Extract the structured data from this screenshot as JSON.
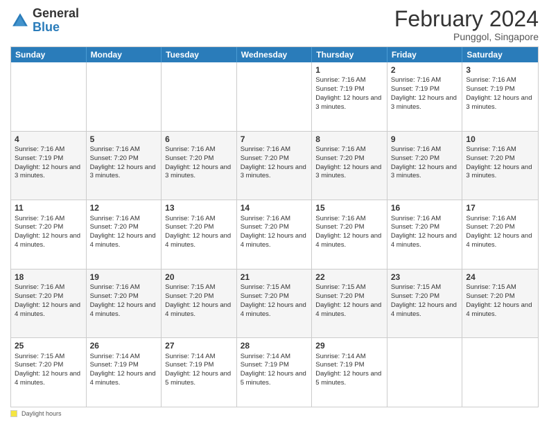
{
  "header": {
    "logo_general": "General",
    "logo_blue": "Blue",
    "month_title": "February 2024",
    "location": "Punggol, Singapore"
  },
  "weekdays": [
    "Sunday",
    "Monday",
    "Tuesday",
    "Wednesday",
    "Thursday",
    "Friday",
    "Saturday"
  ],
  "footer": {
    "daylight_label": "Daylight hours"
  },
  "rows": [
    {
      "cells": [
        {
          "empty": true
        },
        {
          "empty": true
        },
        {
          "empty": true
        },
        {
          "empty": true
        },
        {
          "day": "1",
          "sunrise": "7:16 AM",
          "sunset": "7:19 PM",
          "daylight": "12 hours and 3 minutes."
        },
        {
          "day": "2",
          "sunrise": "7:16 AM",
          "sunset": "7:19 PM",
          "daylight": "12 hours and 3 minutes."
        },
        {
          "day": "3",
          "sunrise": "7:16 AM",
          "sunset": "7:19 PM",
          "daylight": "12 hours and 3 minutes."
        }
      ],
      "alt": false
    },
    {
      "cells": [
        {
          "day": "4",
          "sunrise": "7:16 AM",
          "sunset": "7:19 PM",
          "daylight": "12 hours and 3 minutes."
        },
        {
          "day": "5",
          "sunrise": "7:16 AM",
          "sunset": "7:20 PM",
          "daylight": "12 hours and 3 minutes."
        },
        {
          "day": "6",
          "sunrise": "7:16 AM",
          "sunset": "7:20 PM",
          "daylight": "12 hours and 3 minutes."
        },
        {
          "day": "7",
          "sunrise": "7:16 AM",
          "sunset": "7:20 PM",
          "daylight": "12 hours and 3 minutes."
        },
        {
          "day": "8",
          "sunrise": "7:16 AM",
          "sunset": "7:20 PM",
          "daylight": "12 hours and 3 minutes."
        },
        {
          "day": "9",
          "sunrise": "7:16 AM",
          "sunset": "7:20 PM",
          "daylight": "12 hours and 3 minutes."
        },
        {
          "day": "10",
          "sunrise": "7:16 AM",
          "sunset": "7:20 PM",
          "daylight": "12 hours and 3 minutes."
        }
      ],
      "alt": true
    },
    {
      "cells": [
        {
          "day": "11",
          "sunrise": "7:16 AM",
          "sunset": "7:20 PM",
          "daylight": "12 hours and 4 minutes."
        },
        {
          "day": "12",
          "sunrise": "7:16 AM",
          "sunset": "7:20 PM",
          "daylight": "12 hours and 4 minutes."
        },
        {
          "day": "13",
          "sunrise": "7:16 AM",
          "sunset": "7:20 PM",
          "daylight": "12 hours and 4 minutes."
        },
        {
          "day": "14",
          "sunrise": "7:16 AM",
          "sunset": "7:20 PM",
          "daylight": "12 hours and 4 minutes."
        },
        {
          "day": "15",
          "sunrise": "7:16 AM",
          "sunset": "7:20 PM",
          "daylight": "12 hours and 4 minutes."
        },
        {
          "day": "16",
          "sunrise": "7:16 AM",
          "sunset": "7:20 PM",
          "daylight": "12 hours and 4 minutes."
        },
        {
          "day": "17",
          "sunrise": "7:16 AM",
          "sunset": "7:20 PM",
          "daylight": "12 hours and 4 minutes."
        }
      ],
      "alt": false
    },
    {
      "cells": [
        {
          "day": "18",
          "sunrise": "7:16 AM",
          "sunset": "7:20 PM",
          "daylight": "12 hours and 4 minutes."
        },
        {
          "day": "19",
          "sunrise": "7:16 AM",
          "sunset": "7:20 PM",
          "daylight": "12 hours and 4 minutes."
        },
        {
          "day": "20",
          "sunrise": "7:15 AM",
          "sunset": "7:20 PM",
          "daylight": "12 hours and 4 minutes."
        },
        {
          "day": "21",
          "sunrise": "7:15 AM",
          "sunset": "7:20 PM",
          "daylight": "12 hours and 4 minutes."
        },
        {
          "day": "22",
          "sunrise": "7:15 AM",
          "sunset": "7:20 PM",
          "daylight": "12 hours and 4 minutes."
        },
        {
          "day": "23",
          "sunrise": "7:15 AM",
          "sunset": "7:20 PM",
          "daylight": "12 hours and 4 minutes."
        },
        {
          "day": "24",
          "sunrise": "7:15 AM",
          "sunset": "7:20 PM",
          "daylight": "12 hours and 4 minutes."
        }
      ],
      "alt": true
    },
    {
      "cells": [
        {
          "day": "25",
          "sunrise": "7:15 AM",
          "sunset": "7:20 PM",
          "daylight": "12 hours and 4 minutes."
        },
        {
          "day": "26",
          "sunrise": "7:14 AM",
          "sunset": "7:19 PM",
          "daylight": "12 hours and 4 minutes."
        },
        {
          "day": "27",
          "sunrise": "7:14 AM",
          "sunset": "7:19 PM",
          "daylight": "12 hours and 5 minutes."
        },
        {
          "day": "28",
          "sunrise": "7:14 AM",
          "sunset": "7:19 PM",
          "daylight": "12 hours and 5 minutes."
        },
        {
          "day": "29",
          "sunrise": "7:14 AM",
          "sunset": "7:19 PM",
          "daylight": "12 hours and 5 minutes."
        },
        {
          "empty": true
        },
        {
          "empty": true
        }
      ],
      "alt": false
    }
  ]
}
